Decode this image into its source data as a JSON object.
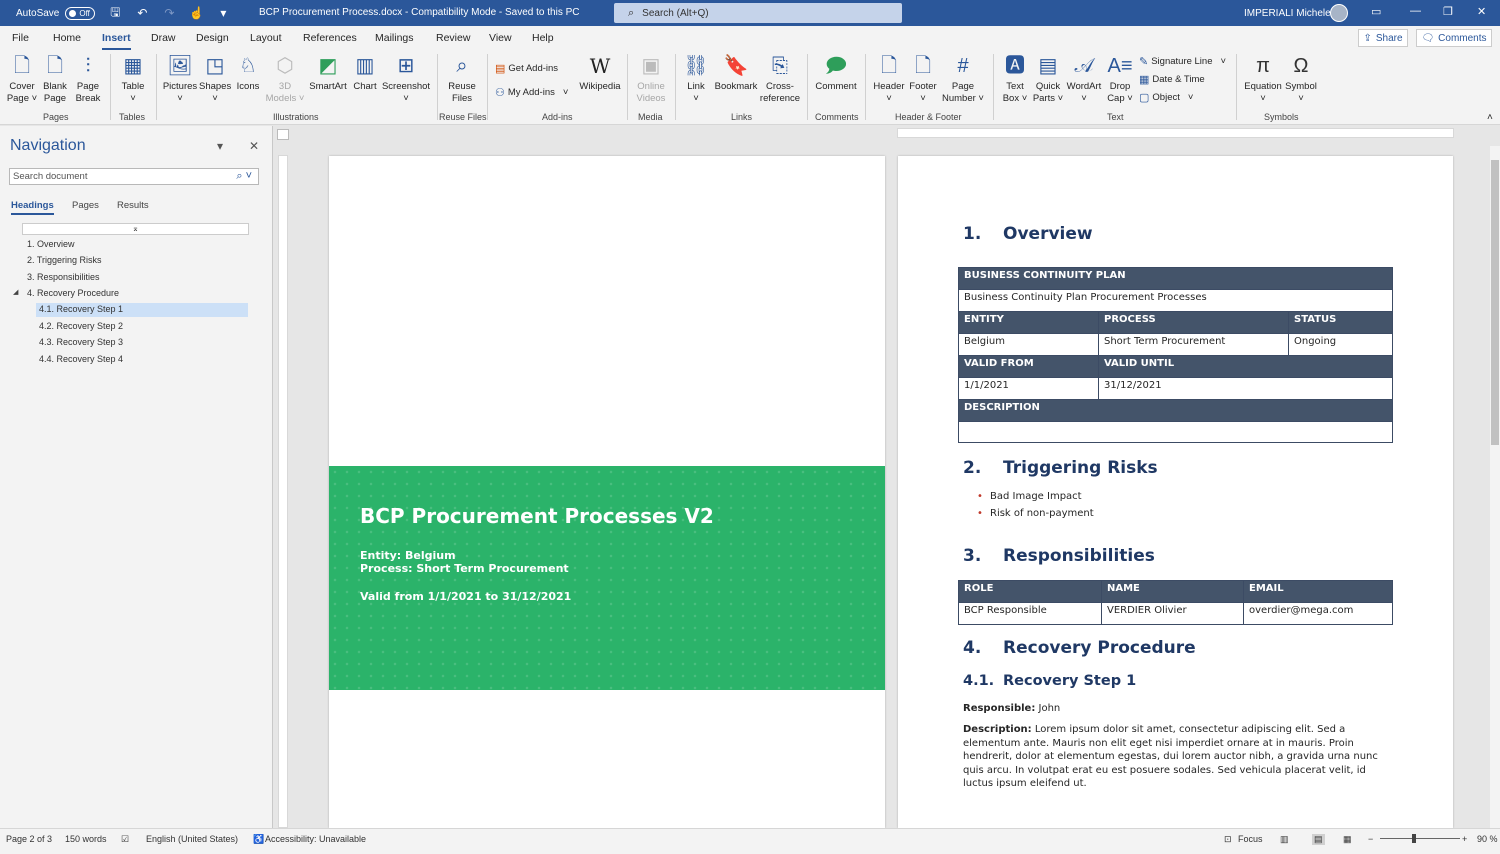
{
  "titlebar": {
    "autosave_label": "AutoSave",
    "autosave_state": "Off",
    "doc_title": "BCP Procurement Process.docx  -  Compatibility Mode  -  Saved to this PC",
    "search_placeholder": "Search (Alt+Q)",
    "user": "IMPERIALI Michele"
  },
  "ribbon_tabs": [
    "File",
    "Home",
    "Insert",
    "Draw",
    "Design",
    "Layout",
    "References",
    "Mailings",
    "Review",
    "View",
    "Help"
  ],
  "share_label": "Share",
  "comments_label": "Comments",
  "ribbon": {
    "pages": {
      "cover": "Cover\nPage ˅",
      "blank": "Blank\nPage",
      "break": "Page\nBreak",
      "group": "Pages"
    },
    "tables": {
      "table": "Table\n˅",
      "group": "Tables"
    },
    "illustrations": {
      "pictures": "Pictures\n˅",
      "shapes": "Shapes\n˅",
      "icons": "Icons",
      "models": "3D\nModels ˅",
      "smartart": "SmartArt",
      "chart": "Chart",
      "screenshot": "Screenshot\n˅",
      "group": "Illustrations"
    },
    "reuse": {
      "files": "Reuse\nFiles",
      "group": "Reuse Files"
    },
    "addins": {
      "get": "Get Add-ins",
      "my": "My Add-ins",
      "wikipedia": "Wikipedia",
      "group": "Add-ins"
    },
    "media": {
      "online": "Online\nVideos",
      "group": "Media"
    },
    "links": {
      "link": "Link\n˅",
      "bookmark": "Bookmark",
      "crossref": "Cross-\nreference",
      "group": "Links"
    },
    "comments": {
      "comment": "Comment",
      "group": "Comments"
    },
    "headerfooter": {
      "header": "Header\n˅",
      "footer": "Footer\n˅",
      "pagenum": "Page\nNumber ˅",
      "group": "Header & Footer"
    },
    "text": {
      "textbox": "Text\nBox ˅",
      "quickparts": "Quick\nParts ˅",
      "wordart": "WordArt\n˅",
      "dropcap": "Drop\nCap ˅",
      "sigline": "Signature Line",
      "datetime": "Date & Time",
      "object": "Object",
      "group": "Text"
    },
    "symbols": {
      "equation": "Equation\n˅",
      "symbol": "Symbol\n˅",
      "group": "Symbols"
    }
  },
  "navigation": {
    "title": "Navigation",
    "search_placeholder": "Search document",
    "tabs": [
      "Headings",
      "Pages",
      "Results"
    ],
    "headings": [
      {
        "label": "1. Overview"
      },
      {
        "label": "2. Triggering Risks"
      },
      {
        "label": "3. Responsibilities"
      },
      {
        "label": "4. Recovery Procedure"
      },
      {
        "label": "4.1. Recovery Step 1",
        "selected": true
      },
      {
        "label": "4.2. Recovery Step 2"
      },
      {
        "label": "4.3. Recovery Step 3"
      },
      {
        "label": "4.4. Recovery Step 4"
      }
    ]
  },
  "cover": {
    "title": "BCP Procurement Processes V2",
    "entity": "Entity: Belgium",
    "process": "Process: Short Term Procurement",
    "valid": "Valid from 1/1/2021 to 31/12/2021",
    "color": "#2bb36a"
  },
  "document": {
    "s1": {
      "num": "1.",
      "title": "Overview"
    },
    "bcp_table": {
      "header": "BUSINESS CONTINUITY PLAN",
      "name": "Business Continuity Plan Procurement Processes",
      "col_entity": "ENTITY",
      "col_process": "PROCESS",
      "col_status": "STATUS",
      "entity": "Belgium",
      "process": "Short Term Procurement",
      "status": "Ongoing",
      "col_from": "VALID FROM",
      "col_until": "VALID UNTIL",
      "from": "1/1/2021",
      "until": "31/12/2021",
      "col_desc": "DESCRIPTION",
      "desc": ""
    },
    "s2": {
      "num": "2.",
      "title": "Triggering Risks",
      "items": [
        "Bad Image Impact",
        "Risk of non-payment"
      ]
    },
    "s3": {
      "num": "3.",
      "title": "Responsibilities"
    },
    "resp_table": {
      "col_role": "ROLE",
      "col_name": "NAME",
      "col_email": "EMAIL",
      "role": "BCP Responsible",
      "name": "VERDIER Olivier",
      "email": "overdier@mega.com"
    },
    "s4": {
      "num": "4.",
      "title": "Recovery Procedure"
    },
    "s41": {
      "num": "4.1.",
      "title": "Recovery Step 1"
    },
    "responsible_label": "Responsible:",
    "responsible_value": " John",
    "description_label": "Description:",
    "description_text": " Lorem ipsum dolor sit amet, consectetur adipiscing elit. Sed a elementum ante. Mauris non elit eget nisi imperdiet ornare at in mauris. Proin hendrerit, dolor at elementum egestas, dui lorem auctor nibh, a gravida urna nunc quis arcu. In volutpat erat eu est posuere sodales. Sed vehicula placerat velit, id luctus ipsum eleifend ut."
  },
  "statusbar": {
    "page": "Page 2 of 3",
    "words": "150 words",
    "language": "English (United States)",
    "accessibility": "Accessibility: Unavailable",
    "focus": "Focus",
    "zoom": "90 %"
  },
  "colors": {
    "brand": "#2b579a",
    "table_header": "#44546a",
    "heading": "#1f3864"
  }
}
